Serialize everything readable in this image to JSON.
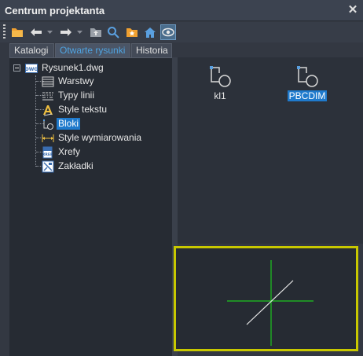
{
  "window": {
    "title": "Centrum projektanta"
  },
  "toolbar": {
    "buttons": [
      {
        "name": "open-folder-icon"
      },
      {
        "name": "back-arrow-icon"
      },
      {
        "name": "forward-arrow-icon"
      },
      {
        "name": "up-folder-icon"
      },
      {
        "name": "search-icon"
      },
      {
        "name": "favorites-icon"
      },
      {
        "name": "home-icon"
      },
      {
        "name": "preview-toggle-icon",
        "active": true
      }
    ]
  },
  "tabs": [
    {
      "label": "Katalogi",
      "active": false
    },
    {
      "label": "Otwarte rysunki",
      "active": true
    },
    {
      "label": "Historia",
      "active": false
    }
  ],
  "tree": {
    "root": {
      "label": "Rysunek1.dwg",
      "icon": "dwg-file-icon"
    },
    "children": [
      {
        "label": "Warstwy",
        "icon": "layers-icon",
        "selected": false
      },
      {
        "label": "Typy linii",
        "icon": "linetypes-icon",
        "selected": false
      },
      {
        "label": "Style tekstu",
        "icon": "text-style-icon",
        "selected": false
      },
      {
        "label": "Bloki",
        "icon": "blocks-icon",
        "selected": true
      },
      {
        "label": "Style wymiarowania",
        "icon": "dimension-style-icon",
        "selected": false
      },
      {
        "label": "Xrefy",
        "icon": "xref-icon",
        "selected": false
      },
      {
        "label": "Zakładki",
        "icon": "layouts-icon",
        "selected": false
      }
    ]
  },
  "blocks": [
    {
      "label": "kl1",
      "selected": false
    },
    {
      "label": "PBCDIM",
      "selected": true
    }
  ],
  "colors": {
    "accent": "#1f7acc",
    "active_tab_text": "#4fa3e0",
    "preview_border": "#c8c800",
    "preview_green": "#1ec81e"
  }
}
